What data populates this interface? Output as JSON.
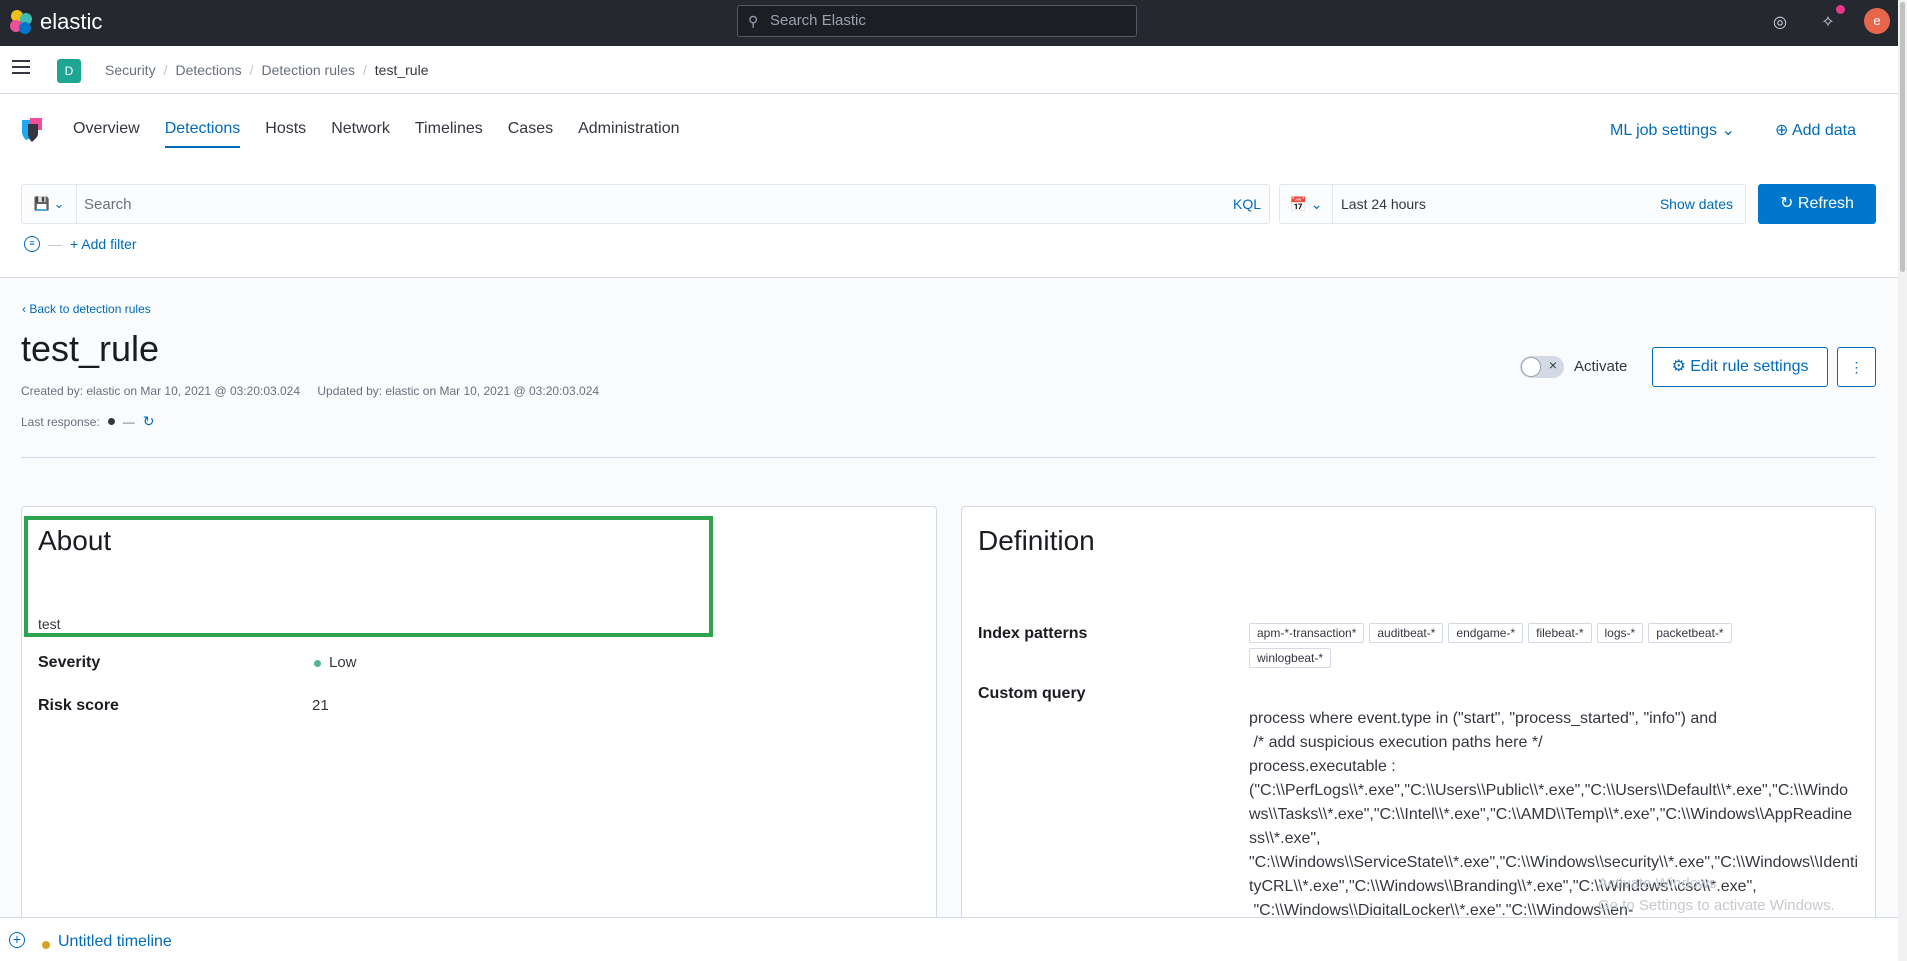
{
  "topbar": {
    "brand": "elastic",
    "search_placeholder": "Search Elastic",
    "avatar_letter": "e"
  },
  "breadcrumb": {
    "space": "D",
    "items": [
      "Security",
      "Detections",
      "Detection rules",
      "test_rule"
    ]
  },
  "nav": {
    "tabs": [
      "Overview",
      "Detections",
      "Hosts",
      "Network",
      "Timelines",
      "Cases",
      "Administration"
    ],
    "active_tab": "Detections",
    "ml_settings": "ML job settings",
    "add_data": "Add data"
  },
  "query": {
    "placeholder": "Search",
    "language": "KQL",
    "date_range": "Last 24 hours",
    "show_dates": "Show dates",
    "refresh": "Refresh",
    "add_filter": "+ Add filter"
  },
  "rule": {
    "back_link": "Back to detection rules",
    "title": "test_rule",
    "created": "Created by: elastic on Mar 10, 2021 @ 03:20:03.024",
    "updated": "Updated by: elastic on Mar 10, 2021 @ 03:20:03.024",
    "last_response_label": "Last response:",
    "last_response_value": "—",
    "activate_label": "Activate",
    "edit_button": "Edit rule settings"
  },
  "about": {
    "heading": "About",
    "description": "test",
    "severity_label": "Severity",
    "severity_value": "Low",
    "risk_label": "Risk score",
    "risk_value": "21"
  },
  "definition": {
    "heading": "Definition",
    "index_label": "Index patterns",
    "index_patterns": [
      "apm-*-transaction*",
      "auditbeat-*",
      "endgame-*",
      "filebeat-*",
      "logs-*",
      "packetbeat-*",
      "winlogbeat-*"
    ],
    "query_label": "Custom query",
    "query_text": "process where event.type in (\"start\", \"process_started\", \"info\") and\n /* add suspicious execution paths here */\nprocess.executable :\n(\"C:\\\\PerfLogs\\\\*.exe\",\"C:\\\\Users\\\\Public\\\\*.exe\",\"C:\\\\Users\\\\Default\\\\*.exe\",\"C:\\\\Windows\\\\Tasks\\\\*.exe\",\"C:\\\\Intel\\\\*.exe\",\"C:\\\\AMD\\\\Temp\\\\*.exe\",\"C:\\\\Windows\\\\AppReadiness\\\\*.exe\",\n\"C:\\\\Windows\\\\ServiceState\\\\*.exe\",\"C:\\\\Windows\\\\security\\\\*.exe\",\"C:\\\\Windows\\\\IdentityCRL\\\\*.exe\",\"C:\\\\Windows\\\\Branding\\\\*.exe\",\"C:\\\\Windows\\\\csc\\\\*.exe\",\n \"C:\\\\Windows\\\\DigitalLocker\\\\*.exe\",\"C:\\\\Windows\\\\en-"
  },
  "watermark": {
    "line1": "Activate Windows",
    "line2": "Go to Settings to activate Windows."
  },
  "timeline": {
    "name": "Untitled timeline"
  },
  "colors": {
    "accent": "#006bb8",
    "highlight": "#2ea44f",
    "severity_low": "#54b399"
  }
}
